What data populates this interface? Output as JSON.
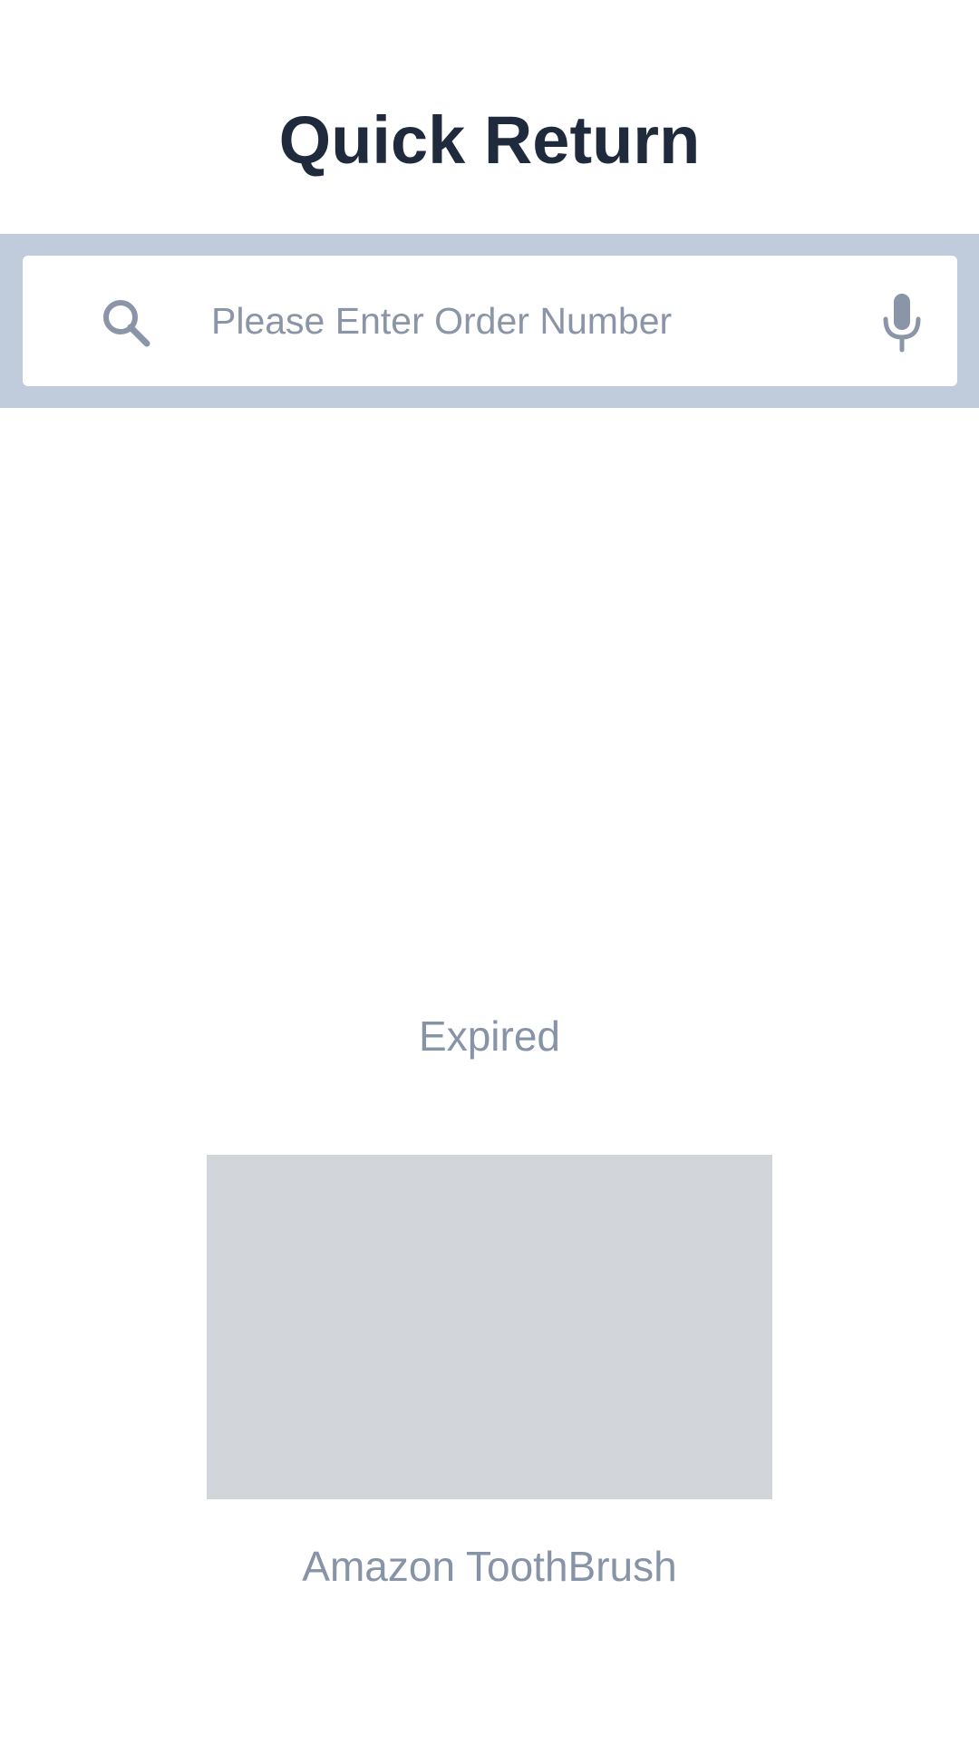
{
  "header": {
    "title": "Quick Return"
  },
  "search": {
    "placeholder": "Please Enter Order Number",
    "value": "",
    "left_icon": "search-icon",
    "right_icon": "microphone-icon"
  },
  "order": {
    "status": "Expired",
    "product_name": "Amazon ToothBrush"
  },
  "colors": {
    "title": "#1f2a3c",
    "search_band": "#c0ccdb",
    "icon": "#8a95a8",
    "muted_text": "#8793a6",
    "image_placeholder": "#d2d6db"
  }
}
